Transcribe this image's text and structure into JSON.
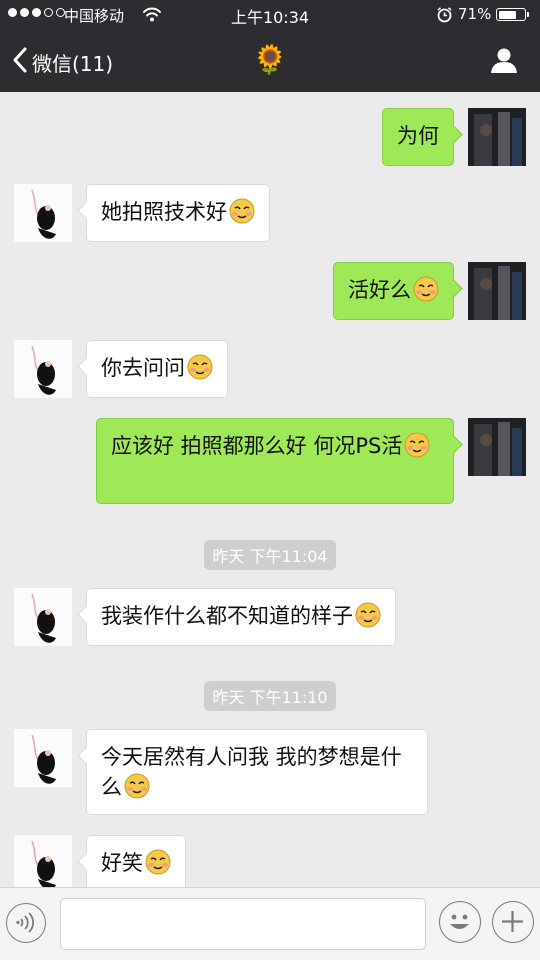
{
  "status_bar": {
    "carrier": "中国移动",
    "time": "上午10:34",
    "battery_percent": "71%",
    "battery_level": 0.71,
    "signal_strength": 3,
    "signal_max": 5
  },
  "nav": {
    "back_label": "微信(11)",
    "title_icon": "🌻",
    "profile_icon": "person-icon"
  },
  "colors": {
    "header_bg": "#2d2d31",
    "chat_bg": "#ebebeb",
    "outgoing_bubble": "#9fe858",
    "incoming_bubble": "#ffffff"
  },
  "messages": [
    {
      "side": "out",
      "text": "为何",
      "emoji": false
    },
    {
      "side": "in",
      "text": "她拍照技术好",
      "emoji": true
    },
    {
      "side": "out",
      "text": "活好么",
      "emoji": true
    },
    {
      "side": "in",
      "text": "你去问问",
      "emoji": true
    },
    {
      "side": "out",
      "text": "应该好  拍照都那么好 何况PS活",
      "emoji": true
    },
    {
      "side": "time",
      "text": "昨天 下午11:04"
    },
    {
      "side": "in",
      "text": "我装作什么都不知道的样子",
      "emoji": true
    },
    {
      "side": "time",
      "text": "昨天 下午11:10"
    },
    {
      "side": "in",
      "text": "今天居然有人问我 我的梦想是什么",
      "emoji": true
    },
    {
      "side": "in",
      "text": "好笑",
      "emoji": true
    }
  ],
  "input_bar": {
    "voice_icon": "voice-icon",
    "input_value": "",
    "emoji_icon": "emoji-icon",
    "plus_icon": "plus-icon"
  }
}
